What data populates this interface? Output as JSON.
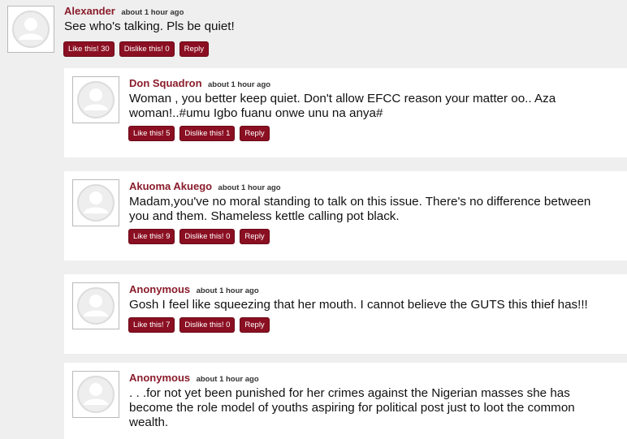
{
  "comments": [
    {
      "author": "Alexander",
      "time": "about 1 hour ago",
      "text": "See who's talking. Pls be quiet!",
      "like": "Like this! 30",
      "dislike": "Dislike this! 0",
      "reply": "Reply"
    },
    {
      "author": "Don Squadron",
      "time": "about 1 hour ago",
      "text": "Woman , you better keep quiet. Don't allow EFCC reason your matter oo.. Aza woman!..#umu Igbo fuanu onwe unu na anya#",
      "like": "Like this! 5",
      "dislike": "Dislike this! 1",
      "reply": "Reply"
    },
    {
      "author": "Akuoma Akuego",
      "time": "about 1 hour ago",
      "text": "Madam,you've no moral standing to talk on this issue. There's no difference between you and them. Shameless kettle calling pot black.",
      "like": "Like this! 9",
      "dislike": "Dislike this! 0",
      "reply": "Reply"
    },
    {
      "author": "Anonymous",
      "time": "about 1 hour ago",
      "text": "Gosh I feel like squeezing that her mouth. I cannot believe the GUTS this thief has!!!",
      "like": "Like this! 7",
      "dislike": "Dislike this! 0",
      "reply": "Reply"
    },
    {
      "author": "Anonymous",
      "time": "about 1 hour ago",
      "text": ". . .for not yet been punished for her crimes against the Nigerian masses she has become the role model of youths aspiring for political post just to loot the common wealth.",
      "like": "",
      "dislike": "",
      "reply": ""
    }
  ]
}
